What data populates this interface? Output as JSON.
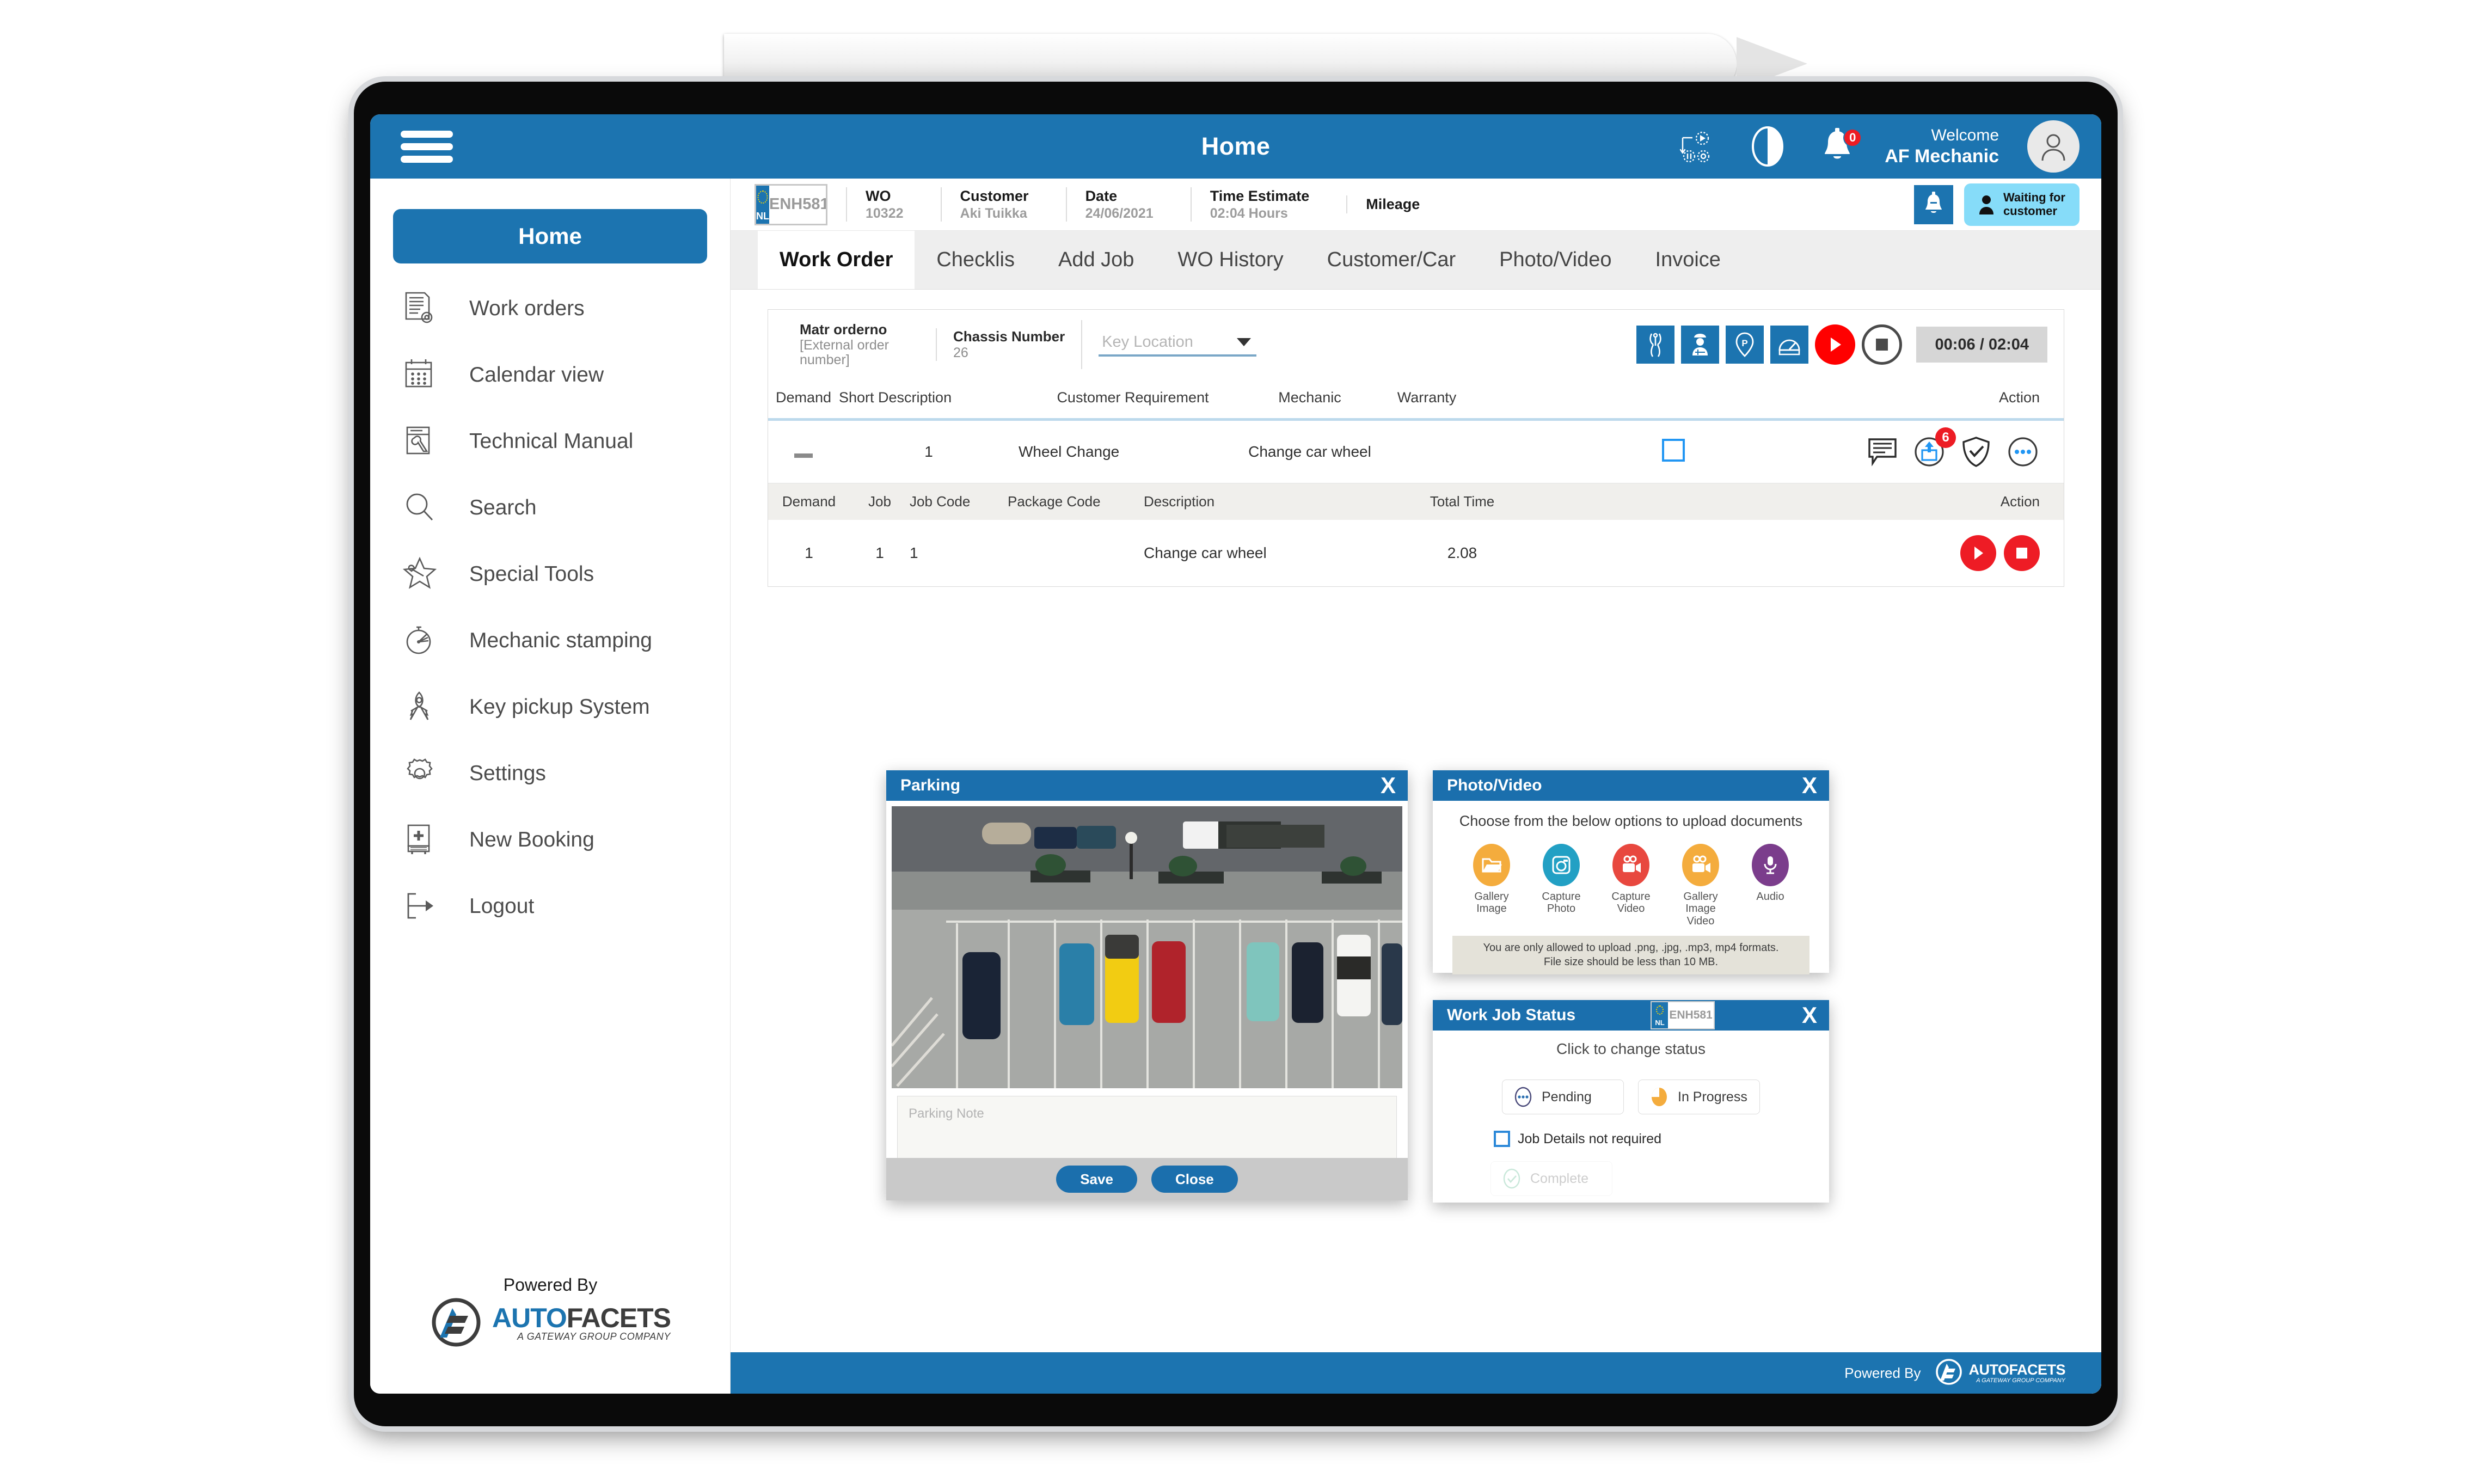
{
  "header": {
    "title": "Home",
    "welcome_line1": "Welcome",
    "welcome_line2": "AF Mechanic",
    "notification_badge": "0",
    "icons": [
      "workflow-icon",
      "half-circle-progress-icon",
      "bell-icon",
      "avatar"
    ]
  },
  "sidebar": {
    "active_item": "Home",
    "items": [
      {
        "label": "Home",
        "icon": "home-icon"
      },
      {
        "label": "Work orders",
        "icon": "document-gear-icon"
      },
      {
        "label": "Calendar view",
        "icon": "calendar-icon"
      },
      {
        "label": "Technical Manual",
        "icon": "manual-wrench-icon"
      },
      {
        "label": "Search",
        "icon": "magnifier-icon"
      },
      {
        "label": "Special Tools",
        "icon": "star-tool-icon"
      },
      {
        "label": "Mechanic stamping",
        "icon": "stopwatch-icon"
      },
      {
        "label": "Key pickup System",
        "icon": "key-icon"
      },
      {
        "label": "Settings",
        "icon": "gear-icon"
      },
      {
        "label": "New Booking",
        "icon": "book-plus-icon"
      },
      {
        "label": "Logout",
        "icon": "logout-arrow-icon"
      }
    ],
    "footer": {
      "powered_by": "Powered By",
      "brand_auto": "AUTO",
      "brand_facets": "FACETS",
      "brand_tagline": "A GATEWAY GROUP COMPANY"
    }
  },
  "wo_bar": {
    "plate_country": "NL",
    "plate_number": "ENH581",
    "fields": [
      {
        "key": "WO",
        "value": "10322"
      },
      {
        "key": "Customer",
        "value": "Aki Tuikka"
      },
      {
        "key": "Date",
        "value": "24/06/2021"
      },
      {
        "key": "Time Estimate",
        "value": "02:04 Hours"
      },
      {
        "key": "Mileage",
        "value": ""
      }
    ],
    "bell_icon": "bell-mute-icon",
    "status_line1": "Waiting for",
    "status_line2": "customer",
    "status_color": "#86dcf9"
  },
  "tabs": [
    {
      "label": "Work Order",
      "active": true
    },
    {
      "label": "Checklis",
      "active": false
    },
    {
      "label": "Add Job",
      "active": false
    },
    {
      "label": "WO History",
      "active": false
    },
    {
      "label": "Customer/Car",
      "active": false
    },
    {
      "label": "Photo/Video",
      "active": false
    },
    {
      "label": "Invoice",
      "active": false
    }
  ],
  "panel": {
    "matr_key": "Matr orderno",
    "matr_sub": "[External order number]",
    "chassis_key": "Chassis Number",
    "chassis_value": "26",
    "key_location_placeholder": "Key Location",
    "action_icons": [
      "tools-pliers-icon",
      "mechanic-icon",
      "parking-pin-icon",
      "speedometer-icon"
    ],
    "timer": "00:06 / 02:04",
    "demand_table": {
      "columns": [
        "Demand",
        "Short Description",
        "Customer Requirement",
        "Mechanic",
        "Warranty",
        "",
        "Action"
      ],
      "rows": [
        {
          "expander": "—",
          "demand": "1",
          "short_description": "Wheel Change",
          "customer_requirement": "Change car wheel",
          "mechanic": "",
          "warranty_checked": false,
          "actions": [
            "comment-icon",
            "upload-icon",
            "shield-check-icon",
            "more-options-icon"
          ],
          "upload_badge": "6"
        }
      ]
    },
    "job_table": {
      "columns": [
        "Demand",
        "Job",
        "Job Code",
        "Package Code",
        "Description",
        "Total Time",
        "Action"
      ],
      "rows": [
        {
          "demand": "1",
          "job": "1",
          "job_code": "1",
          "package_code": "",
          "description": "Change car wheel",
          "total_time": "2.08",
          "actions": [
            "play-icon",
            "stop-icon"
          ]
        }
      ]
    }
  },
  "dialogs": {
    "parking": {
      "title": "Parking",
      "close": "X",
      "note_placeholder": "Parking Note",
      "save_label": "Save",
      "close_label": "Close"
    },
    "photo_video": {
      "title": "Photo/Video",
      "close": "X",
      "heading": "Choose from the below options to upload documents",
      "options": [
        {
          "label1": "Gallery",
          "label2": "Image",
          "label3": "",
          "color": "#f4ac3d",
          "icon": "folder-icon"
        },
        {
          "label1": "Capture",
          "label2": "Photo",
          "label3": "",
          "color": "#22a0c4",
          "icon": "camera-icon"
        },
        {
          "label1": "Capture",
          "label2": "Video",
          "label3": "",
          "color": "#e8483f",
          "icon": "video-camera-icon"
        },
        {
          "label1": "Gallery",
          "label2": "Image",
          "label3": "Video",
          "color": "#f4ac3d",
          "icon": "video-camera-icon"
        },
        {
          "label1": "Audio",
          "label2": "",
          "label3": "",
          "color": "#7b3d8c",
          "icon": "microphone-icon"
        }
      ],
      "note_line1": "You are only allowed to upload .png, .jpg, .mp3, mp4 formats.",
      "note_line2": "File size should be less than 10 MB."
    },
    "work_job_status": {
      "title": "Work Job Status",
      "close": "X",
      "plate_country": "NL",
      "plate_number": "ENH581",
      "heading": "Click to change status",
      "status_pending": "Pending",
      "status_in_progress": "In Progress",
      "checkbox_label": "Job Details not required",
      "status_complete": "Complete",
      "in_progress_color": "#f4ac3d"
    }
  },
  "app_footer": {
    "powered_by": "Powered By",
    "brand_auto": "AUTO",
    "brand_facets": "FACETS",
    "brand_tagline": "A GATEWAY GROUP COMPANY"
  },
  "theme": {
    "primary": "#1c74b0",
    "header": "#1b6fad",
    "accent_red": "#ee1c25"
  }
}
